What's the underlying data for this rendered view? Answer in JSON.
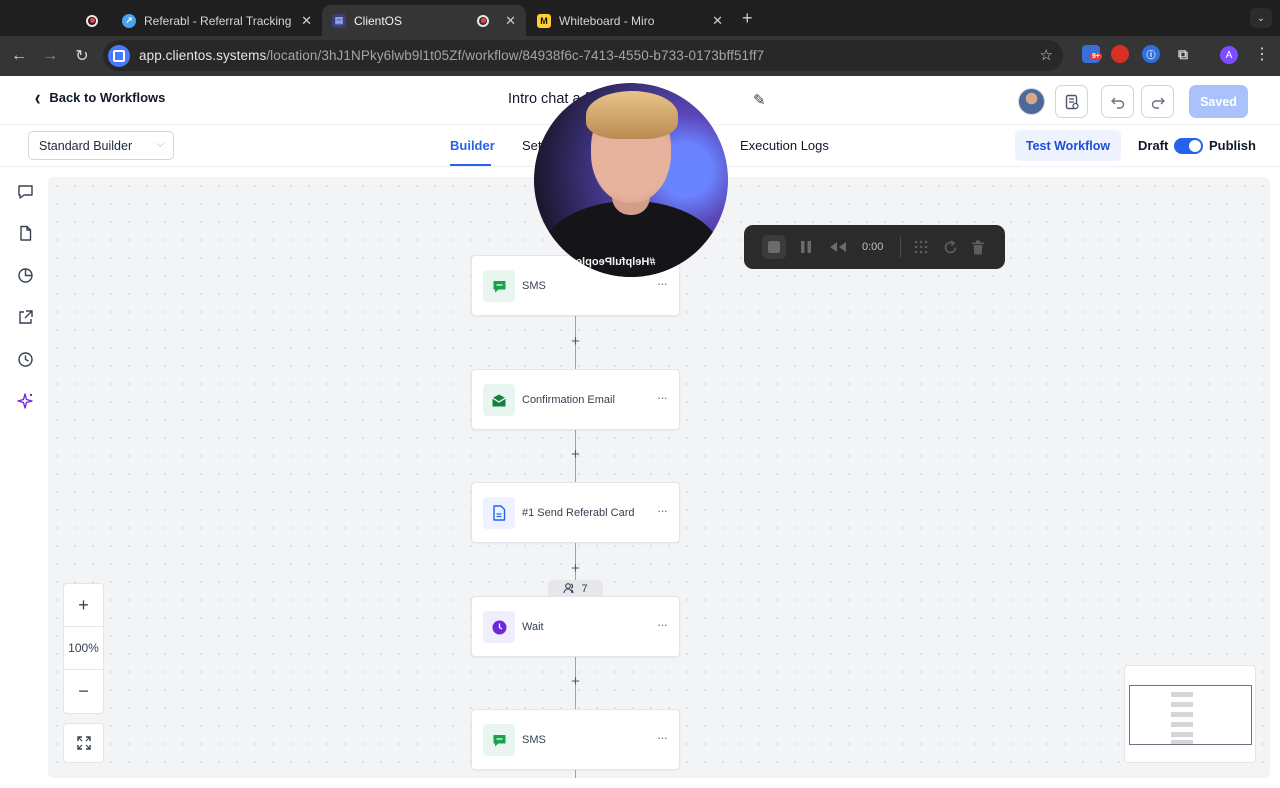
{
  "browser": {
    "tabs": [
      {
        "title": "Referabl - Referral Tracking P",
        "close": "✕"
      },
      {
        "title": "ClientOS",
        "close": "✕",
        "active": true
      },
      {
        "title": "Whiteboard - Miro",
        "close": "✕"
      }
    ],
    "new_tab": "+",
    "url_host": "app.clientos.systems",
    "url_path": "/location/3hJ1NPky6lwb9l1t05Zf/workflow/84938f6c-7413-4550-b733-0173bff51ff7",
    "extension_badge": "9+",
    "profile_initial": "A"
  },
  "header": {
    "back_label": "Back to Workflows",
    "workflow_title": "Intro chat a               firmation",
    "saved_label": "Saved"
  },
  "subheader": {
    "builder_mode": "Standard Builder",
    "tabs": [
      "Builder",
      "Set",
      "Execution Logs"
    ],
    "active_tab": "Builder",
    "test_label": "Test Workflow",
    "draft_label": "Draft",
    "publish_label": "Publish",
    "publish_on": true
  },
  "workflow": {
    "nodes": [
      {
        "label": "SMS",
        "icon": "sms-icon"
      },
      {
        "label": "Confirmation Email",
        "icon": "email-icon"
      },
      {
        "label": "#1 Send Referabl Card",
        "icon": "document-icon"
      },
      {
        "label": "Wait",
        "icon": "clock-icon"
      },
      {
        "label": "SMS",
        "icon": "sms-icon"
      }
    ],
    "wait_contacts_count": "7",
    "node_menu": "···",
    "add_step": "+"
  },
  "zoom": {
    "in": "+",
    "level": "100%",
    "out": "−"
  },
  "recorder": {
    "time": "0:00"
  },
  "webcam": {
    "shirt_text": "#HelpfulPeople"
  },
  "colors": {
    "accent": "#2563eb",
    "saved_button": "#a9c2fb",
    "sms_icon": "#16a34a",
    "email_icon": "#15803d",
    "document_icon": "#2563eb",
    "wait_icon": "#6d28d9"
  }
}
